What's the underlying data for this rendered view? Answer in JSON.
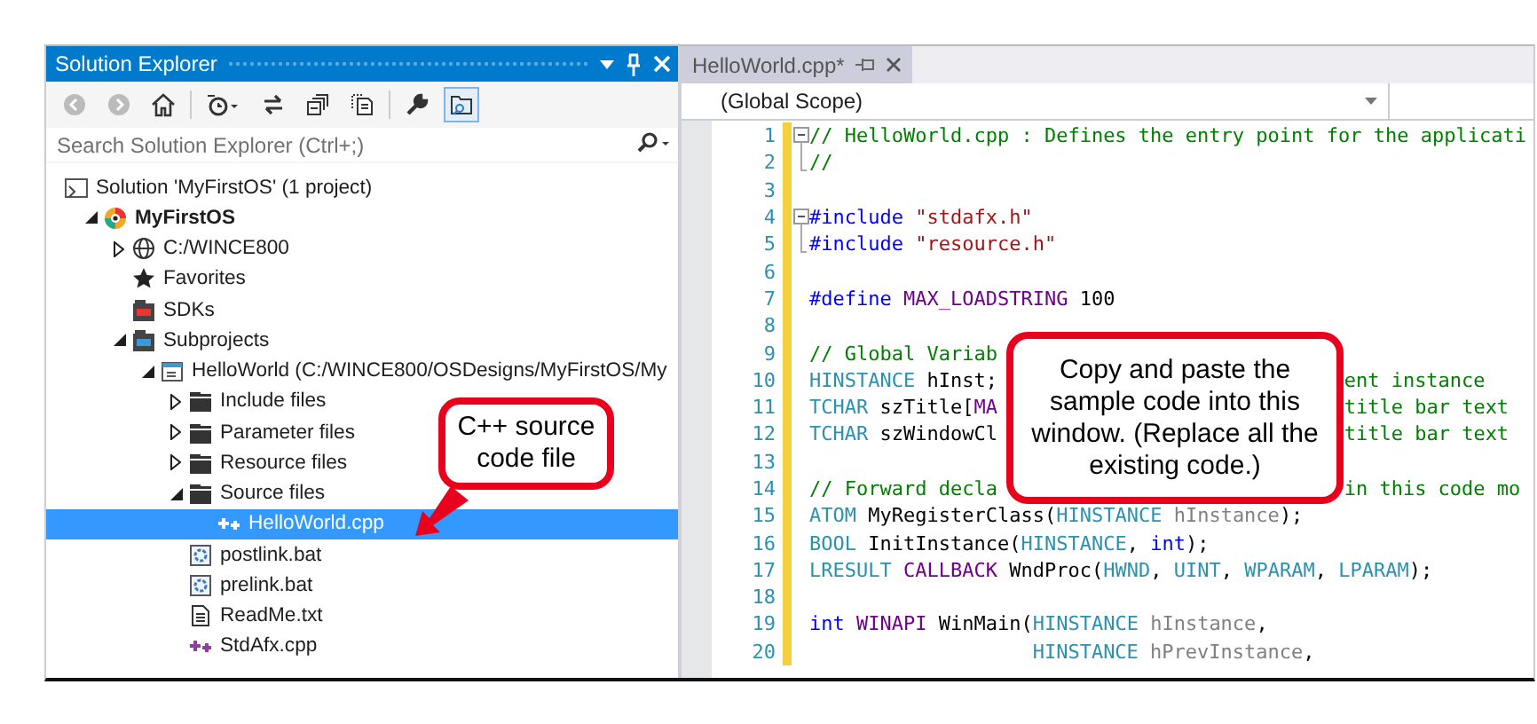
{
  "solution_explorer": {
    "title": "Solution Explorer",
    "search": {
      "placeholder": "Search Solution Explorer (Ctrl+;)"
    },
    "toolbar": [
      {
        "kind": "back",
        "disabled": true
      },
      {
        "kind": "forward",
        "disabled": true
      },
      {
        "kind": "home",
        "disabled": false
      },
      {
        "kind": "history",
        "disabled": false
      },
      {
        "kind": "sync",
        "disabled": false
      },
      {
        "kind": "collapse",
        "disabled": false
      },
      {
        "kind": "files",
        "disabled": false
      },
      {
        "kind": "wrench",
        "disabled": false
      },
      {
        "kind": "preview",
        "disabled": false,
        "selected": true
      }
    ],
    "tree": [
      {
        "label": "Solution 'MyFirstOS' (1 project)",
        "kind": "solution",
        "children": [
          {
            "label": "MyFirstOS",
            "kind": "project",
            "bold": true,
            "expanded": true,
            "children": [
              {
                "label": "C:/WINCE800",
                "kind": "globe",
                "expanded": false
              },
              {
                "label": "Favorites",
                "kind": "star"
              },
              {
                "label": "SDKs",
                "kind": "sdk"
              },
              {
                "label": "Subprojects",
                "kind": "subprojects",
                "expanded": true,
                "children": [
                  {
                    "label": "HelloWorld (C:/WINCE800/OSDesigns/MyFirstOS/My",
                    "kind": "subproject",
                    "expanded": true,
                    "children": [
                      {
                        "label": "Include files",
                        "kind": "folder",
                        "expanded": false
                      },
                      {
                        "label": "Parameter files",
                        "kind": "folder",
                        "expanded": false
                      },
                      {
                        "label": "Resource files",
                        "kind": "folder",
                        "expanded": false
                      },
                      {
                        "label": "Source files",
                        "kind": "folder",
                        "expanded": true,
                        "children": [
                          {
                            "label": "HelloWorld.cpp",
                            "kind": "cpp",
                            "selected": true
                          }
                        ]
                      },
                      {
                        "label": "postlink.bat",
                        "kind": "bat",
                        "selected": false
                      },
                      {
                        "label": "prelink.bat",
                        "kind": "bat",
                        "selected": false
                      },
                      {
                        "label": "ReadMe.txt",
                        "kind": "txt",
                        "selected": false
                      },
                      {
                        "label": "StdAfx.cpp",
                        "kind": "cpp",
                        "selected": false
                      }
                    ]
                  }
                ]
              }
            ]
          }
        ]
      }
    ]
  },
  "editor": {
    "tab": {
      "label": "HelloWorld.cpp*",
      "selected": true
    },
    "scope": "(Global Scope)",
    "lines": [
      {
        "number": "1",
        "fold_start": true,
        "segments": [
          {
            "kind": "comment",
            "text": "// HelloWorld.cpp : Defines the entry point for the applicati"
          }
        ]
      },
      {
        "number": "2",
        "fold_end": true,
        "segments": [
          {
            "kind": "comment",
            "text": "//"
          }
        ]
      },
      {
        "number": "3"
      },
      {
        "number": "4",
        "fold_start": true,
        "segments": [
          {
            "kind": "keyword",
            "text": "#include"
          },
          {
            "kind": "string",
            "text": " \"stdafx.h\""
          }
        ]
      },
      {
        "number": "5",
        "fold_end": true,
        "segments": [
          {
            "kind": "keyword",
            "text": "#include"
          },
          {
            "kind": "string",
            "text": " \"resource.h\""
          }
        ]
      },
      {
        "number": "6"
      },
      {
        "number": "7",
        "segments": [
          {
            "kind": "keyword",
            "text": "#define"
          },
          {
            "kind": "macro",
            "text": " MAX_LOADSTRING"
          },
          {
            "kind": "plain",
            "text": " 100"
          }
        ]
      },
      {
        "number": "8"
      },
      {
        "number": "9",
        "segments": [
          {
            "kind": "comment",
            "text": "// Global Variab"
          }
        ]
      },
      {
        "number": "10",
        "segments": [
          {
            "kind": "type",
            "text": "HINSTANCE"
          },
          {
            "kind": "plain",
            "text": " hInst;"
          }
        ],
        "after_callout": [
          {
            "kind": "comment",
            "text": "ent instance"
          }
        ]
      },
      {
        "number": "11",
        "segments": [
          {
            "kind": "type",
            "text": "TCHAR"
          },
          {
            "kind": "plain",
            "text": " szTitle["
          },
          {
            "kind": "macro",
            "text": "MA"
          }
        ],
        "after_callout": [
          {
            "kind": "comment",
            "text": "title bar text"
          }
        ]
      },
      {
        "number": "12",
        "segments": [
          {
            "kind": "type",
            "text": "TCHAR"
          },
          {
            "kind": "plain",
            "text": " szWindowCl"
          }
        ],
        "after_callout": [
          {
            "kind": "comment",
            "text": "title bar text"
          }
        ]
      },
      {
        "number": "13"
      },
      {
        "number": "14",
        "segments": [
          {
            "kind": "comment",
            "text": "// Forward decla"
          }
        ],
        "after_callout": [
          {
            "kind": "comment",
            "text": "in this code mo"
          }
        ]
      },
      {
        "number": "15",
        "segments": [
          {
            "kind": "type",
            "text": "ATOM"
          },
          {
            "kind": "plain",
            "text": " MyRegisterClass("
          },
          {
            "kind": "type",
            "text": "HINSTANCE"
          },
          {
            "kind": "param",
            "text": " hInstance"
          },
          {
            "kind": "plain",
            "text": ");"
          }
        ]
      },
      {
        "number": "16",
        "segments": [
          {
            "kind": "type",
            "text": "BOOL"
          },
          {
            "kind": "plain",
            "text": " InitInstance("
          },
          {
            "kind": "type",
            "text": "HINSTANCE"
          },
          {
            "kind": "plain",
            "text": ", "
          },
          {
            "kind": "keyword",
            "text": "int"
          },
          {
            "kind": "plain",
            "text": ");"
          }
        ]
      },
      {
        "number": "17",
        "segments": [
          {
            "kind": "type",
            "text": "LRESULT"
          },
          {
            "kind": "macro",
            "text": " CALLBACK"
          },
          {
            "kind": "plain",
            "text": " WndProc("
          },
          {
            "kind": "type",
            "text": "HWND"
          },
          {
            "kind": "plain",
            "text": ", "
          },
          {
            "kind": "type",
            "text": "UINT"
          },
          {
            "kind": "plain",
            "text": ", "
          },
          {
            "kind": "type",
            "text": "WPARAM"
          },
          {
            "kind": "plain",
            "text": ", "
          },
          {
            "kind": "type",
            "text": "LPARAM"
          },
          {
            "kind": "plain",
            "text": ");"
          }
        ]
      },
      {
        "number": "18"
      },
      {
        "number": "19",
        "segments": [
          {
            "kind": "keyword",
            "text": "int"
          },
          {
            "kind": "macro",
            "text": " WINAPI"
          },
          {
            "kind": "plain",
            "text": " WinMain("
          },
          {
            "kind": "type",
            "text": "HINSTANCE"
          },
          {
            "kind": "param",
            "text": " hInstance"
          },
          {
            "kind": "plain",
            "text": ","
          }
        ]
      },
      {
        "number": "20",
        "segments": [
          {
            "kind": "type",
            "text": "                   HINSTANCE"
          },
          {
            "kind": "param",
            "text": " hPrevInstance"
          },
          {
            "kind": "plain",
            "text": ","
          }
        ]
      }
    ]
  },
  "callouts": [
    {
      "kind": "file",
      "text": "C++ source code file"
    },
    {
      "kind": "code",
      "text": "Copy and paste the sample code into this window. (Replace all the existing code.)"
    }
  ]
}
